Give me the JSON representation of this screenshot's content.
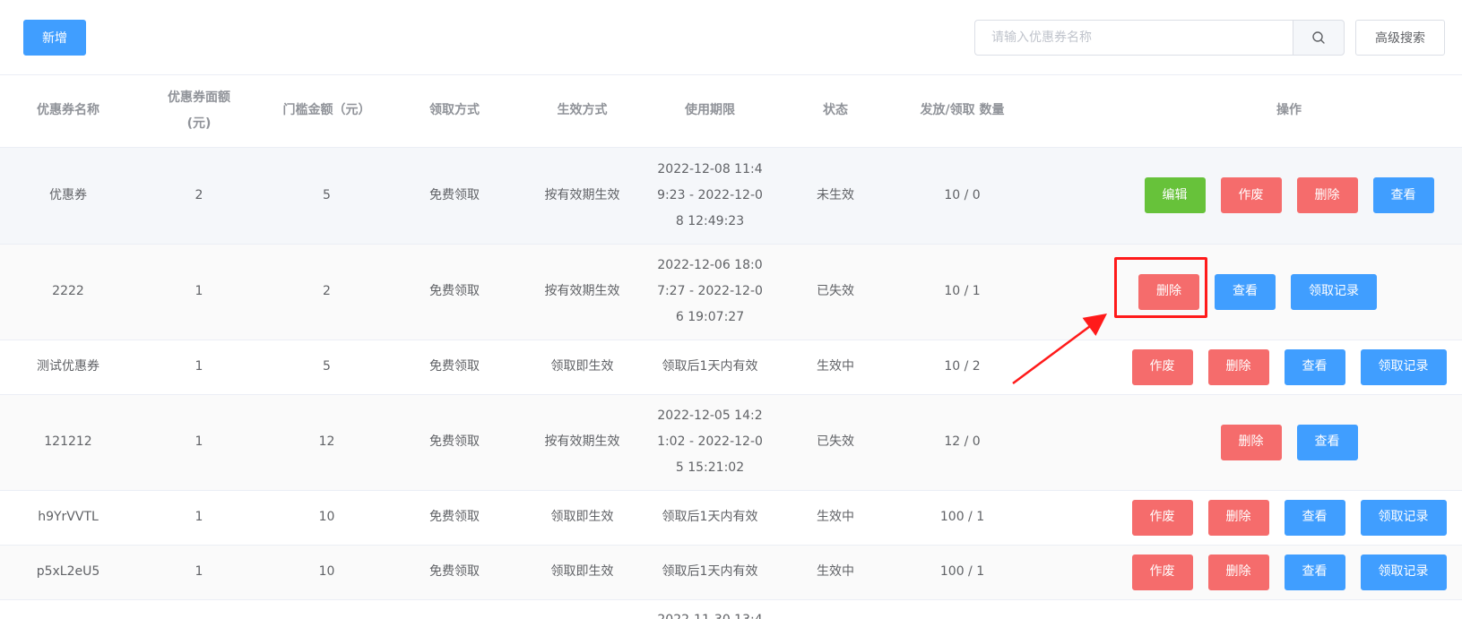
{
  "toolbar": {
    "add_label": "新增",
    "search_placeholder": "请输入优惠券名称",
    "search_value": "",
    "advanced_label": "高级搜索"
  },
  "table": {
    "headers": {
      "name": "优惠券名称",
      "face_value": "优惠券面额(元)",
      "threshold": "门槛金额（元）",
      "claim_method": "领取方式",
      "effect_method": "生效方式",
      "period": "使用期限",
      "status": "状态",
      "quantity": "发放/领取 数量",
      "actions": "操作"
    },
    "rows": [
      {
        "name": "优惠券",
        "face_value": "2",
        "threshold": "5",
        "claim_method": "免费领取",
        "effect_method": "按有效期生效",
        "period": "2022-12-08 11:49:23 - 2022-12-08 12:49:23",
        "status": "未生效",
        "quantity": "10 / 0",
        "actions": [
          {
            "label": "编辑",
            "type": "success"
          },
          {
            "label": "作废",
            "type": "danger"
          },
          {
            "label": "删除",
            "type": "danger"
          },
          {
            "label": "查看",
            "type": "primary"
          }
        ]
      },
      {
        "name": "2222",
        "face_value": "1",
        "threshold": "2",
        "claim_method": "免费领取",
        "effect_method": "按有效期生效",
        "period": "2022-12-06 18:07:27 - 2022-12-06 19:07:27",
        "status": "已失效",
        "quantity": "10 / 1",
        "actions": [
          {
            "label": "删除",
            "type": "danger"
          },
          {
            "label": "查看",
            "type": "primary"
          },
          {
            "label": "领取记录",
            "type": "primary"
          }
        ]
      },
      {
        "name": "测试优惠券",
        "face_value": "1",
        "threshold": "5",
        "claim_method": "免费领取",
        "effect_method": "领取即生效",
        "period": "领取后1天内有效",
        "status": "生效中",
        "quantity": "10 / 2",
        "actions": [
          {
            "label": "作废",
            "type": "danger"
          },
          {
            "label": "删除",
            "type": "danger"
          },
          {
            "label": "查看",
            "type": "primary"
          },
          {
            "label": "领取记录",
            "type": "primary"
          }
        ]
      },
      {
        "name": "121212",
        "face_value": "1",
        "threshold": "12",
        "claim_method": "免费领取",
        "effect_method": "按有效期生效",
        "period": "2022-12-05 14:21:02 - 2022-12-05 15:21:02",
        "status": "已失效",
        "quantity": "12 / 0",
        "actions": [
          {
            "label": "删除",
            "type": "danger"
          },
          {
            "label": "查看",
            "type": "primary"
          }
        ]
      },
      {
        "name": "h9YrVVTL",
        "face_value": "1",
        "threshold": "10",
        "claim_method": "免费领取",
        "effect_method": "领取即生效",
        "period": "领取后1天内有效",
        "status": "生效中",
        "quantity": "100 / 1",
        "actions": [
          {
            "label": "作废",
            "type": "danger"
          },
          {
            "label": "删除",
            "type": "danger"
          },
          {
            "label": "查看",
            "type": "primary"
          },
          {
            "label": "领取记录",
            "type": "primary"
          }
        ]
      },
      {
        "name": "p5xL2eU5",
        "face_value": "1",
        "threshold": "10",
        "claim_method": "免费领取",
        "effect_method": "领取即生效",
        "period": "领取后1天内有效",
        "status": "生效中",
        "quantity": "100 / 1",
        "actions": [
          {
            "label": "作废",
            "type": "danger"
          },
          {
            "label": "删除",
            "type": "danger"
          },
          {
            "label": "查看",
            "type": "primary"
          },
          {
            "label": "领取记录",
            "type": "primary"
          }
        ]
      },
      {
        "name": "",
        "face_value": "",
        "threshold": "",
        "claim_method": "",
        "effect_method": "",
        "period": "2022-11-30 13:4",
        "status": "",
        "quantity": "",
        "actions": []
      }
    ]
  },
  "annotation": {
    "color": "#ff1a1a"
  },
  "colors": {
    "primary": "#409eff",
    "danger": "#f56c6c",
    "success": "#67c23a"
  }
}
